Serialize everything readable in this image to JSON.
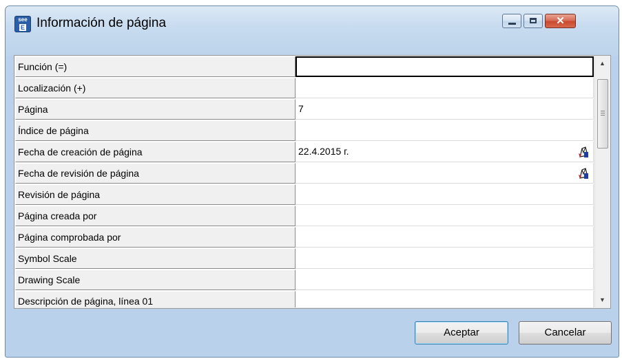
{
  "window": {
    "title": "Información de página",
    "icon": {
      "name": "see-e-app-icon",
      "top_text": "see",
      "bottom_text": "E"
    },
    "controls": [
      "minimize",
      "maximize",
      "close"
    ]
  },
  "properties": [
    {
      "label": "Función (=)",
      "value": "",
      "active": true,
      "has_icon": false
    },
    {
      "label": "Localización (+)",
      "value": "",
      "has_icon": false
    },
    {
      "label": "Página",
      "value": "7",
      "has_icon": false
    },
    {
      "label": "Índice de página",
      "value": "",
      "has_icon": false
    },
    {
      "label": "Fecha de creación de página",
      "value": "22.4.2015 г.",
      "has_icon": true
    },
    {
      "label": "Fecha de revisión de página",
      "value": "",
      "has_icon": true
    },
    {
      "label": "Revisión de página",
      "value": "",
      "has_icon": false
    },
    {
      "label": "Página creada por",
      "value": "",
      "has_icon": false
    },
    {
      "label": "Página comprobada por",
      "value": "",
      "has_icon": false
    },
    {
      "label": "Symbol Scale",
      "value": "",
      "has_icon": false
    },
    {
      "label": "Drawing Scale",
      "value": "",
      "has_icon": false
    },
    {
      "label": "Descripción de página, línea 01",
      "value": "",
      "has_icon": false
    }
  ],
  "buttons": {
    "ok_label": "Aceptar",
    "cancel_label": "Cancelar"
  },
  "colors": {
    "window_frame": "#b9d1ea",
    "close_button": "#c84a2f",
    "default_button_border": "#3c7fb1"
  }
}
